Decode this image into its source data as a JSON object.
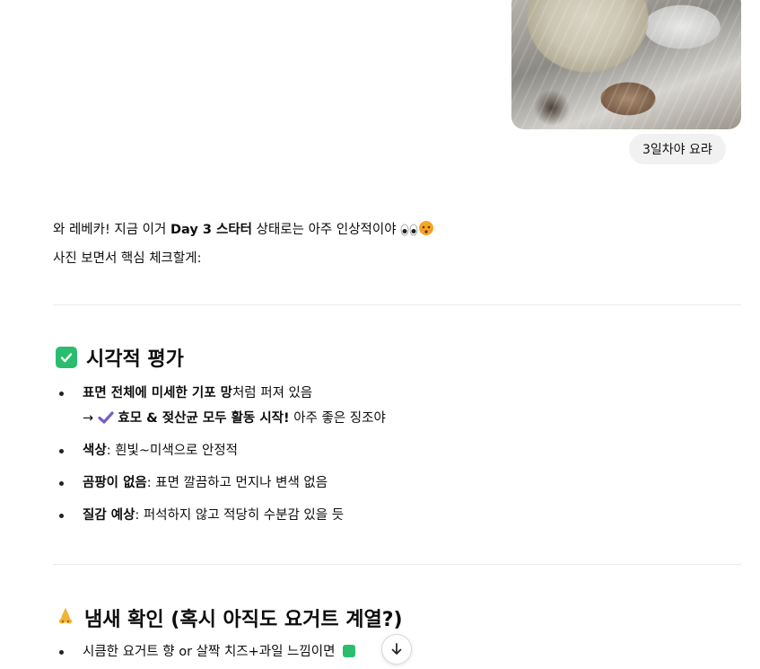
{
  "user_message": {
    "caption": "3일차야 요랴"
  },
  "assistant": {
    "intro_line1_a": "와 레베카! 지금 이거 ",
    "intro_line1_b": "Day 3 스타터",
    "intro_line1_c": " 상태로는 아주 인상적이야 ",
    "intro_line2": "사진 보면서 핵심 체크할게:",
    "section1": {
      "title": "시각적 평가",
      "items": [
        {
          "bold": "표면 전체에 미세한 기포 망",
          "rest": "처럼 퍼져 있음"
        },
        {
          "bold": "색상",
          "rest": ": 흰빛~미색으로 안정적"
        },
        {
          "bold": "곰팡이 없음",
          "rest": ": 표면 깔끔하고 먼지나 변색 없음"
        },
        {
          "bold": "질감 예상",
          "rest": ": 퍼석하지 않고 적당히 수분감 있을 듯"
        }
      ],
      "sub_arrow": "→ ",
      "sub_bold": "효모 & 젖산균 모두 활동 시작!",
      "sub_rest": " 아주 좋은 징조야"
    },
    "section2": {
      "title": "냄새 확인 (혹시 아직도 요거트 계열?)",
      "items": [
        {
          "text": "시큼한 요거트 향 or 살짝 치즈+과일 느낌이면 "
        }
      ]
    }
  },
  "colors": {
    "accent_green": "#2bbd6e",
    "check_purple": "#7b5cc4",
    "bubble_bg": "#f1f1f1"
  },
  "icons": {
    "section1": "check-box-icon",
    "section2": "nose-icon",
    "scroll": "arrow-down-icon"
  }
}
